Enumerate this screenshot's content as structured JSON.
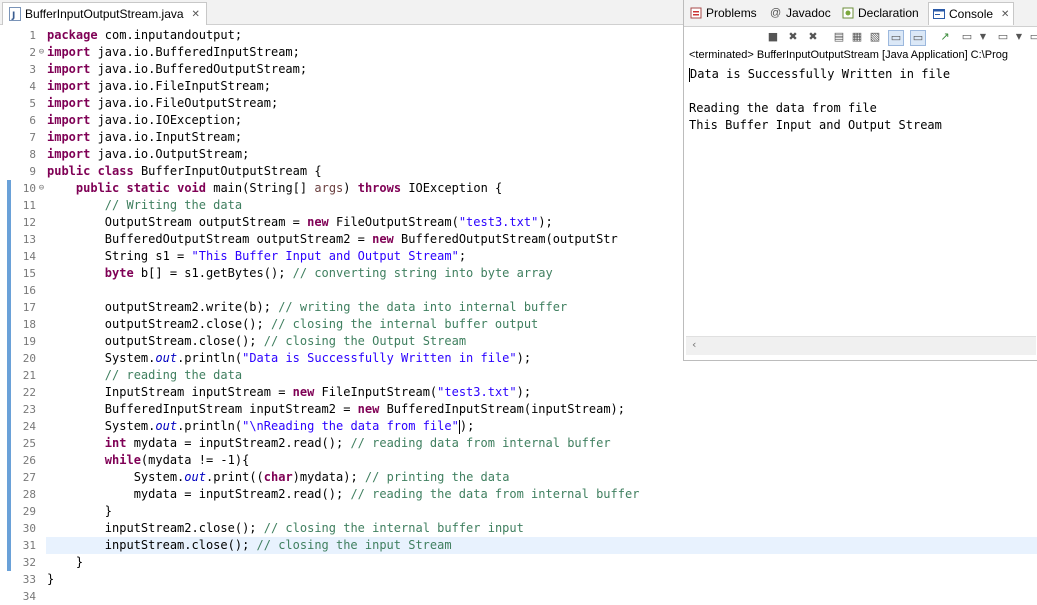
{
  "editor": {
    "tab_title": "BufferInputOutputStream.java",
    "tab_close": "✕",
    "lines": [
      {
        "n": "1",
        "t": "package com.inputandoutput;"
      },
      {
        "n": "2",
        "t": "import java.io.BufferedInputStream;"
      },
      {
        "n": "3",
        "t": "import java.io.BufferedOutputStream;"
      },
      {
        "n": "4",
        "t": "import java.io.FileInputStream;"
      },
      {
        "n": "5",
        "t": "import java.io.FileOutputStream;"
      },
      {
        "n": "6",
        "t": "import java.io.IOException;"
      },
      {
        "n": "7",
        "t": "import java.io.InputStream;"
      },
      {
        "n": "8",
        "t": "import java.io.OutputStream;"
      },
      {
        "n": "9",
        "t": "public class BufferInputOutputStream {"
      },
      {
        "n": "10",
        "t": "    public static void main(String[] args) throws IOException {"
      },
      {
        "n": "11",
        "t": "        // Writing the data"
      },
      {
        "n": "12",
        "t": "        OutputStream outputStream = new FileOutputStream(\"test3.txt\");"
      },
      {
        "n": "13",
        "t": "        BufferedOutputStream outputStream2 = new BufferedOutputStream(outputStr"
      },
      {
        "n": "14",
        "t": "        String s1 = \"This Buffer Input and Output Stream\";"
      },
      {
        "n": "15",
        "t": "        byte b[] = s1.getBytes(); // converting string into byte array"
      },
      {
        "n": "16",
        "t": ""
      },
      {
        "n": "17",
        "t": "        outputStream2.write(b); // writing the data into internal buffer"
      },
      {
        "n": "18",
        "t": "        outputStream2.close(); // closing the internal buffer output"
      },
      {
        "n": "19",
        "t": "        outputStream.close(); // closing the Output Stream"
      },
      {
        "n": "20",
        "t": "        System.out.println(\"Data is Successfully Written in file\");"
      },
      {
        "n": "21",
        "t": "        // reading the data"
      },
      {
        "n": "22",
        "t": "        InputStream inputStream = new FileInputStream(\"test3.txt\");"
      },
      {
        "n": "23",
        "t": "        BufferedInputStream inputStream2 = new BufferedInputStream(inputStream);"
      },
      {
        "n": "24",
        "t": "        System.out.println(\"\\nReading the data from file\");"
      },
      {
        "n": "25",
        "t": "        int mydata = inputStream2.read(); // reading data from internal buffer"
      },
      {
        "n": "26",
        "t": "        while(mydata != -1){"
      },
      {
        "n": "27",
        "t": "            System.out.print((char)mydata); // printing the data"
      },
      {
        "n": "28",
        "t": "            mydata = inputStream2.read(); // reading the data from internal buffer"
      },
      {
        "n": "29",
        "t": "        }"
      },
      {
        "n": "30",
        "t": "        inputStream2.close(); // closing the internal buffer input"
      },
      {
        "n": "31",
        "t": "        inputStream.close(); // closing the input Stream"
      },
      {
        "n": "32",
        "t": "    }"
      },
      {
        "n": "33",
        "t": "}"
      },
      {
        "n": "34",
        "t": ""
      }
    ]
  },
  "console": {
    "tabs": [
      {
        "label": "Problems",
        "icon": "problems-icon"
      },
      {
        "label": "Javadoc",
        "icon": "javadoc-icon"
      },
      {
        "label": "Declaration",
        "icon": "declaration-icon"
      },
      {
        "label": "Console",
        "icon": "console-icon"
      }
    ],
    "tab_close": "✕",
    "status": "<terminated> BufferInputOutputStream [Java Application] C:\\Prog",
    "output": [
      "Data is Successfully Written in file",
      "",
      "Reading the data from file",
      "This Buffer Input and Output Stream"
    ]
  },
  "colors": {
    "keyword": "#7f0055",
    "string": "#2a00ff",
    "comment": "#3f7f5f",
    "field": "#0000c0",
    "current_line": "#e8f2fe",
    "change_bar": "#6aa1d8"
  }
}
